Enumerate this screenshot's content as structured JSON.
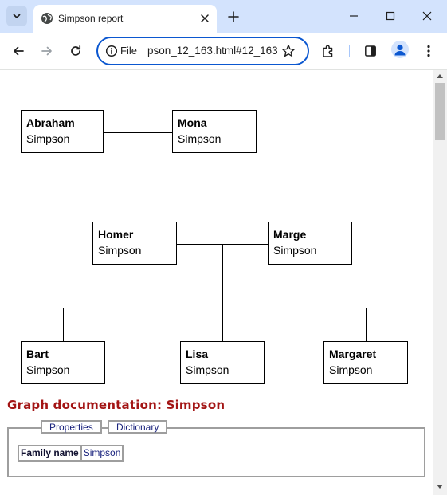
{
  "browser": {
    "tab_title": "Simpson report",
    "omnibox_scheme_label": "File",
    "omnibox_url": "pson_12_163.html#12_163",
    "icons": {
      "tab_search": "chevron-down-icon",
      "favicon": "globe-icon",
      "tab_close": "close-icon",
      "new_tab": "plus-icon",
      "minimize": "minimize-icon",
      "maximize": "maximize-icon",
      "close_window": "close-icon",
      "back": "back-arrow-icon",
      "forward": "forward-arrow-icon",
      "reload": "reload-icon",
      "site_info": "info-icon",
      "bookmark": "star-icon",
      "extensions": "puzzle-icon",
      "side_panel": "side-panel-icon",
      "profile": "avatar-icon",
      "menu": "kebab-menu-icon"
    },
    "colors": {
      "tabstrip_bg": "#d3e3fd",
      "omnibox_border": "#0b57d0"
    }
  },
  "graph": {
    "people": {
      "abraham": {
        "first": "Abraham",
        "last": "Simpson"
      },
      "mona": {
        "first": "Mona",
        "last": "Simpson"
      },
      "homer": {
        "first": "Homer",
        "last": "Simpson"
      },
      "marge": {
        "first": "Marge",
        "last": "Simpson"
      },
      "bart": {
        "first": "Bart",
        "last": "Simpson"
      },
      "lisa": {
        "first": "Lisa",
        "last": "Simpson"
      },
      "margaret": {
        "first": "Margaret",
        "last": "Simpson"
      }
    }
  },
  "documentation": {
    "heading": "Graph documentation: Simpson",
    "tabs": {
      "properties": "Properties",
      "dictionary": "Dictionary"
    },
    "properties": {
      "key": "Family name",
      "value": "Simpson"
    },
    "colors": {
      "heading": "#a31515",
      "link": "#1a237e"
    }
  }
}
